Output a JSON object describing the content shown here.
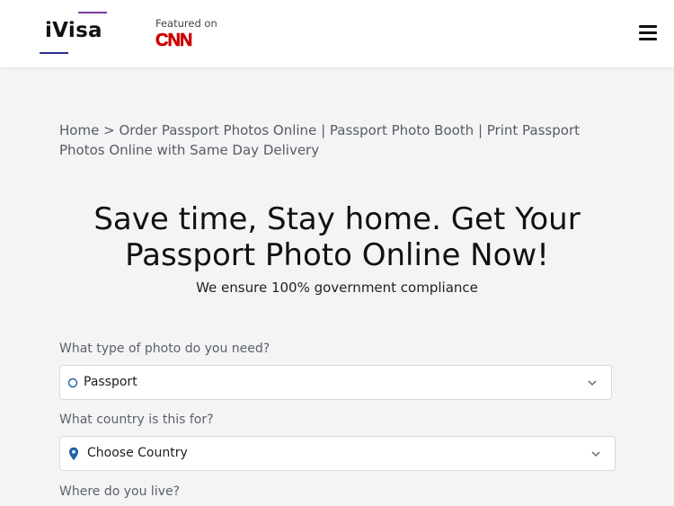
{
  "header": {
    "logo_text": "iVisa",
    "featured_label": "Featured on",
    "featured_logo": "CNN"
  },
  "breadcrumb": {
    "home": "Home",
    "separator": ">",
    "current": "Order Passport Photos Online | Passport Photo Booth | Print Passport Photos Online with Same Day Delivery"
  },
  "hero": {
    "title": "Save time, Stay home. Get Your Passport Photo Online Now!",
    "subtitle": "We ensure 100% government compliance"
  },
  "form": {
    "photo_type_label": "What type of photo do you need?",
    "photo_type_value": "Passport",
    "country_label": "What country is this for?",
    "country_value": "Choose Country",
    "residence_label": "Where do you live?"
  },
  "icons": {
    "menu": "hamburger-menu-icon",
    "photo_type": "circle-icon",
    "country": "location-pin-icon",
    "dropdown": "chevron-down-icon"
  },
  "colors": {
    "brand_purple": "#7b3fa0",
    "brand_navy": "#2b2f8a",
    "cnn_red": "#cc0000",
    "pin_blue": "#1f5fa8"
  }
}
